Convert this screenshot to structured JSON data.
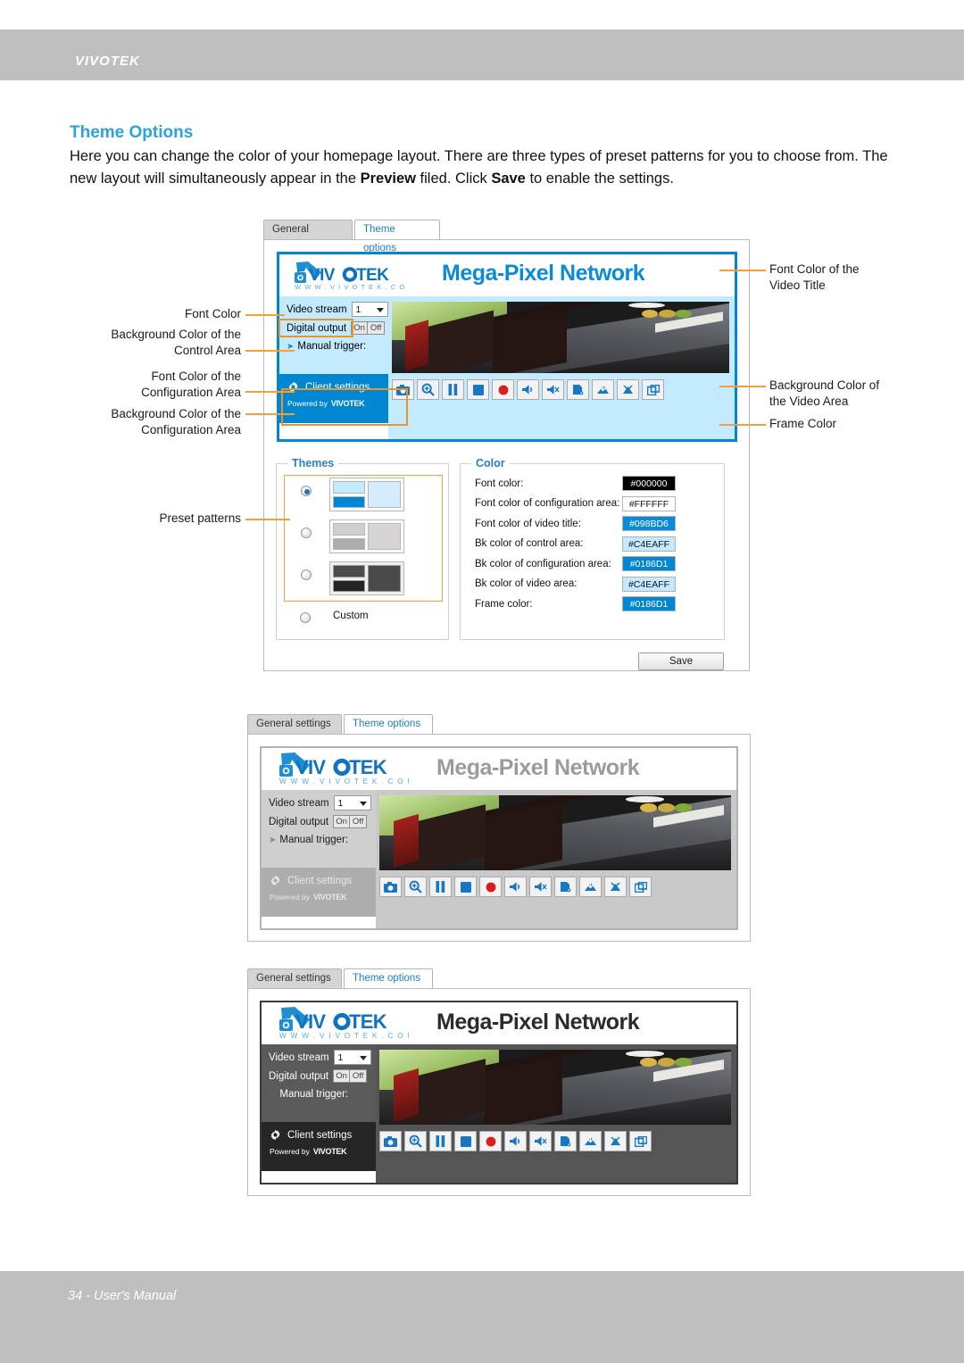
{
  "header": {
    "brand": "VIVOTEK"
  },
  "footer": {
    "page_note": "34 - User's Manual"
  },
  "doc": {
    "title": "Theme Options",
    "paragraph_1": "Here you can change the color of your homepage layout. There are three types of preset patterns for you to choose from. The new layout will simultaneously appear in the ",
    "preview_word": "Preview",
    "paragraph_2": " filed. Click ",
    "save_word": "Save",
    "paragraph_3": " to enable the settings."
  },
  "tabs": {
    "general": "General settings",
    "theme": "Theme options"
  },
  "camera_ui": {
    "video_title": "Mega-Pixel Network",
    "logo_text": "VIVOTEK",
    "logo_url": "W W W . V I V O T E K . C O M",
    "video_stream_label": "Video stream",
    "video_stream_value": "1",
    "digital_output_label": "Digital output",
    "digital_output_on": "On",
    "digital_output_off": "Off",
    "manual_trigger_label": "Manual trigger:",
    "client_settings_label": "Client settings",
    "powered_by_label": "Powered by",
    "powered_by_brand": "VIVOTEK",
    "control_icons": [
      "snapshot-icon",
      "digital-zoom-icon",
      "pause-icon",
      "stop-icon",
      "record-icon",
      "volume-icon",
      "mute-icon",
      "talk-icon",
      "mic-icon",
      "mic-mute-icon",
      "fullscreen-icon"
    ]
  },
  "themes_panel": {
    "legend": "Themes",
    "options": [
      {
        "name": "preset-blue",
        "selected": true,
        "colors": {
          "control": "#C4EAFF",
          "config": "#0186D1",
          "video": "#D4ECFB",
          "frame": "#B0B0B0"
        }
      },
      {
        "name": "preset-gray",
        "selected": false,
        "colors": {
          "control": "#CFCFCF",
          "config": "#ADADAD",
          "video": "#D8D4D6",
          "frame": "#B0B0B0"
        }
      },
      {
        "name": "preset-dark",
        "selected": false,
        "colors": {
          "control": "#4C4C4C",
          "config": "#232323",
          "video": "#4A4A4A",
          "frame": "#6E6E6E"
        }
      }
    ],
    "custom_label": "Custom"
  },
  "color_panel": {
    "legend": "Color",
    "rows": [
      {
        "label": "Font color:",
        "value": "#000000",
        "bg": "#000000",
        "fg": "#FFFFFF"
      },
      {
        "label": "Font color of configuration area:",
        "value": "#FFFFFF",
        "bg": "#FFFFFF",
        "fg": "#111111"
      },
      {
        "label": "Font color of video title:",
        "value": "#098BD6",
        "bg": "#098BD6",
        "fg": "#FFFFFF"
      },
      {
        "label": "Bk color of control area:",
        "value": "#C4EAFF",
        "bg": "#C4EAFF",
        "fg": "#111111"
      },
      {
        "label": "Bk color of configuration area:",
        "value": "#0186D1",
        "bg": "#0186D1",
        "fg": "#FFFFFF"
      },
      {
        "label": "Bk color of video area:",
        "value": "#C4EAFF",
        "bg": "#C4EAFF",
        "fg": "#111111"
      },
      {
        "label": "Frame color:",
        "value": "#0186D1",
        "bg": "#0186D1",
        "fg": "#FFFFFF"
      }
    ]
  },
  "save_button": {
    "label": "Save"
  },
  "annotations": {
    "font_color": "Font Color",
    "bk_control_area": "Background Color of the\nControl Area",
    "font_config_area": "Font Color of the\nConfiguration Area",
    "bk_config_area": "Background Color of the\nConfiguration Area",
    "preset_patterns": "Preset patterns",
    "font_video_title": "Font Color of the\nVideo Title",
    "bk_video_area": "Background Color of\nthe Video Area",
    "frame_color": "Frame Color"
  },
  "theme_variants": [
    {
      "name": "blue-theme",
      "title_color": "#098BD6",
      "control_bg": "#C4EAFF",
      "config_bg": "#0186D1",
      "config_fg": "#FFFFFF",
      "video_bg": "#C4EAFF",
      "frame_color": "#0186D1",
      "font_color": "#000000",
      "trigger_color": "#1E86C6"
    },
    {
      "name": "gray-theme",
      "title_color": "#9B9B9B",
      "control_bg": "#CFCFCF",
      "config_bg": "#ADADAD",
      "config_fg": "#E8E8E8",
      "video_bg": "#C9C9C9",
      "frame_color": "#B3B3B3",
      "font_color": "#1A1A1A",
      "trigger_color": "#6F8FA8"
    },
    {
      "name": "dark-theme",
      "title_color": "#2B2B2B",
      "control_bg": "#5A5A5A",
      "config_bg": "#262626",
      "config_fg": "#FFFFFF",
      "video_bg": "#555555",
      "frame_color": "#3A3A3A",
      "font_color": "#FFFFFF",
      "trigger_color": "#3E6A8C"
    }
  ]
}
